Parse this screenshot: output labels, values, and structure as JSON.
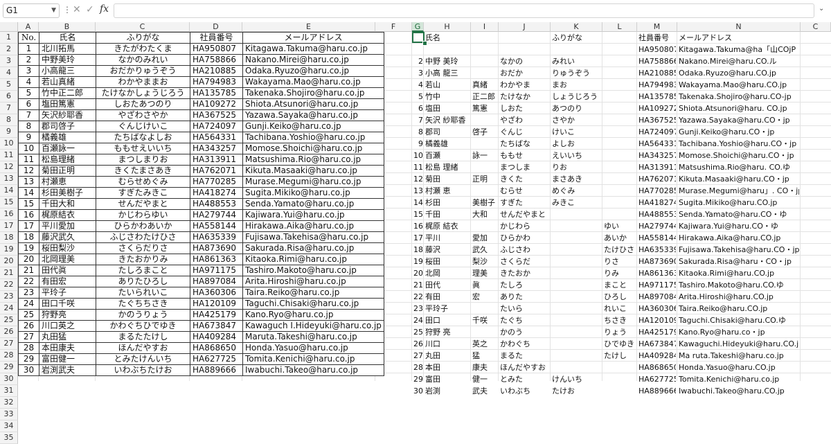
{
  "formula_bar": {
    "name_box": "G1",
    "more_icon": "more-vertical-icon",
    "cancel_icon": "x-icon",
    "enter_icon": "check-icon",
    "fx_label": "fx",
    "formula_value": ""
  },
  "colors": {
    "accent": "#217346",
    "header_bg": "#f3f3f3",
    "grid_line": "#e2e2e2"
  },
  "columns": [
    "A",
    "B",
    "C",
    "D",
    "E",
    "F",
    "G",
    "H",
    "I",
    "J",
    "K",
    "L",
    "M",
    "N",
    "C"
  ],
  "selected_column": "G",
  "row_numbers": [
    "1",
    "2",
    "3",
    "4",
    "5",
    "6",
    "7",
    "8",
    "9",
    "10",
    "11",
    "12",
    "13",
    "14",
    "15",
    "16",
    "17",
    "18",
    "19",
    "20",
    "21",
    "22",
    "23",
    "24",
    "25",
    "26",
    "27",
    "28",
    "29",
    "30",
    "31",
    "32",
    "33",
    "34",
    "35"
  ],
  "table1": {
    "headers": [
      "No.",
      "氏名",
      "ふりがな",
      "社員番号",
      "メールアドレス"
    ],
    "rows": [
      [
        "1",
        "北川拓馬",
        "きたがわたくま",
        "HA950807",
        "Kitagawa.Takuma@haru.co.jp"
      ],
      [
        "2",
        "中野美玲",
        "なかのみれい",
        "HA758866",
        "Nakano.Mirei@haru.co.jp"
      ],
      [
        "3",
        "小高龍三",
        "おだかりゅうぞう",
        "HA210885",
        "Odaka.Ryuzo@haru.co.jp"
      ],
      [
        "4",
        "若山真緒",
        "わかやままお",
        "HA794983",
        "Wakayama.Mao@haru.co.jp"
      ],
      [
        "5",
        "竹中正二郎",
        "たけなかしょうじろう",
        "HA135785",
        "Takenaka.Shojiro@haru.co.jp"
      ],
      [
        "6",
        "塩田篤憲",
        "しおたあつのり",
        "HA109272",
        "Shiota.Atsunori@haru.co.jp"
      ],
      [
        "7",
        "矢沢紗耶香",
        "やざわさやか",
        "HA367525",
        "Yazawa.Sayaka@haru.co.jp"
      ],
      [
        "8",
        "郡司啓子",
        "ぐんじけいこ",
        "HA724097",
        "Gunji.Keiko@haru.co.jp"
      ],
      [
        "9",
        "橘義雄",
        "たちばなよしお",
        "HA564331",
        "Tachibana.Yoshio@haru.co.jp"
      ],
      [
        "10",
        "百瀬詠一",
        "ももせえいいち",
        "HA343257",
        "Momose.Shoichi@haru.co.jp"
      ],
      [
        "11",
        "松島理緒",
        "まつしまりお",
        "HA313911",
        "Matsushima.Rio@haru.co.jp"
      ],
      [
        "12",
        "菊田正明",
        "きくたまさあき",
        "HA762071",
        "Kikuta.Masaaki@haru.co.jp"
      ],
      [
        "13",
        "村瀬恵",
        "むらせめぐみ",
        "HA770285",
        "Murase.Megumi@haru.co.jp"
      ],
      [
        "14",
        "杉田美樹子",
        "すぎたみきこ",
        "HA418274",
        "Sugita.Mikiko@haru.co.jp"
      ],
      [
        "15",
        "千田大和",
        "せんだやまと",
        "HA488553",
        "Senda.Yamato@haru.co.jp"
      ],
      [
        "16",
        "梶原結衣",
        "かじわらゆい",
        "HA279744",
        "Kajiwara.Yui@haru.co.jp"
      ],
      [
        "17",
        "平川愛加",
        "ひらかわあいか",
        "HA558144",
        "Hirakawa.Aika@haru.co.jp"
      ],
      [
        "18",
        "藤沢武久",
        "ふじさわたけひさ",
        "HA635339",
        "Fujisawa.Takehisa@haru.co.jp"
      ],
      [
        "19",
        "桜田梨沙",
        "さくらだりさ",
        "HA873690",
        "Sakurada.Risa@haru.co.jp"
      ],
      [
        "20",
        "北岡理美",
        "きたおかりみ",
        "HA861363",
        "Kitaoka.Rimi@haru.co.jp"
      ],
      [
        "21",
        "田代眞",
        "たしろまこと",
        "HA971175",
        "Tashiro.Makoto@haru.co.jp"
      ],
      [
        "22",
        "有田宏",
        "ありたひろし",
        "HA897084",
        "Arita.Hiroshi@haru.co.jp"
      ],
      [
        "23",
        "平玲子",
        "たいられいこ",
        "HA360306",
        "Taira.Reiko@haru.co.jp"
      ],
      [
        "24",
        "田口千咲",
        "たぐちちさき",
        "HA120109",
        "Taguchi.Chisaki@haru.co.jp"
      ],
      [
        "25",
        "狩野亮",
        "かのうりょう",
        "HA425179",
        "Kano.Ryo@haru.co.jp"
      ],
      [
        "26",
        "川口英之",
        "かわぐちひでゆき",
        "HA673847",
        "Kawaguch I.Hideyuki@haru.co.jp"
      ],
      [
        "27",
        "丸田猛",
        "まるたたけし",
        "HA409284",
        "Maruta.Takeshi@haru.co.jp"
      ],
      [
        "28",
        "本田康夫",
        "ほんだやすお",
        "HA868650",
        "Honda.Yasuo@haru.co.jp"
      ],
      [
        "29",
        "富田健一",
        "とみたけんいち",
        "HA627725",
        "Tomita.Kenichi@haru.co.jp"
      ],
      [
        "30",
        "岩渕武夫",
        "いわぶちたけお",
        "HA889666",
        "Iwabuchi.Takeo@haru.co.jp"
      ]
    ]
  },
  "table2": {
    "headers": {
      "H": "氏名",
      "K": "ふりがな",
      "M": "社員番号",
      "N": "メールアドレス"
    },
    "rows": [
      {
        "G": "",
        "H": "",
        "I": "",
        "J": "",
        "K": "",
        "L": "",
        "M": "HA950807",
        "N": "Kitagawa.Takuma@ha「山COjP"
      },
      {
        "G": "2",
        "H": "中野 美玲",
        "I": "",
        "J": "なかの",
        "K": "みれい",
        "L": "",
        "M": "HA758866",
        "N": "Nakano.Mirei@haru.CO.ル"
      },
      {
        "G": "3",
        "H": "小高 龍三",
        "I": "",
        "J": "おだか",
        "K": "りゅうぞう",
        "L": "",
        "M": "HA210885",
        "N": "Odaka.Ryuzo@haru.CO.jp"
      },
      {
        "G": "4",
        "H": "若山",
        "I": "真緒",
        "J": "わかやま",
        "K": "まお",
        "L": "",
        "M": "HA794983",
        "N": "Wakayama.Mao@haru.CO.jp"
      },
      {
        "G": "5",
        "H": "竹中",
        "I": "正二郎",
        "J": "たけなか",
        "K": "しょうじろう",
        "L": "",
        "M": "HA135785",
        "N": "Takenaka.Shojiro@haru.CO-jp"
      },
      {
        "G": "6",
        "H": "塩田",
        "I": "篤憲",
        "J": "しおた",
        "K": "あつのり",
        "L": "",
        "M": "HA109272",
        "N": "Shiota.Atsunori@haru. CO.jp"
      },
      {
        "G": "7",
        "H": "矢沢 紗耶香",
        "I": "",
        "J": "やざわ",
        "K": "さやか",
        "L": "",
        "M": "HA367525",
        "N": "Yazawa.Sayaka@haru.CO・jp"
      },
      {
        "G": "8",
        "H": "郡司",
        "I": "啓子",
        "J": "ぐんじ",
        "K": "けいこ",
        "L": "",
        "M": "HA724097",
        "N": "Gunji.Keiko@haru.CO・jp"
      },
      {
        "G": "9",
        "H": "橘義雄",
        "I": "",
        "J": "たちばな",
        "K": "よしお",
        "L": "",
        "M": "HA564331",
        "N": "Tachibana.Yoshio@haru.CO・jp"
      },
      {
        "G": "10",
        "H": "百瀬",
        "I": "詠一",
        "J": "ももせ",
        "K": "えいいち",
        "L": "",
        "M": "HA343257",
        "N": "Momose.Shoichi@haru.CO・jp"
      },
      {
        "G": "11",
        "H": "松島 理緒",
        "I": "",
        "J": "まつしま",
        "K": "りお",
        "L": "",
        "M": "HA313911",
        "N": "Matsushima.Rio@haru. CO.ゆ"
      },
      {
        "G": "12",
        "H": "菊田",
        "I": "正明",
        "J": "きくた",
        "K": "まさあき",
        "L": "",
        "M": "HA762071",
        "N": "Kikuta.Masaaki@haru.CO・jp"
      },
      {
        "G": "13",
        "H": "村瀬 恵",
        "I": "",
        "J": "むらせ",
        "K": "めぐみ",
        "L": "",
        "M": "HA770285",
        "N": "Murase.Megumi@haru」. CO・jp"
      },
      {
        "G": "14",
        "H": "杉田",
        "I": "美樹子",
        "J": "すぎた",
        "K": "みきこ",
        "L": "",
        "M": "HA418274",
        "N": "Sugita.Mikiko@haru.CO.jp"
      },
      {
        "G": "15",
        "H": "千田",
        "I": "大和",
        "J": "せんだやまと",
        "K": "",
        "L": "",
        "M": "HA488553",
        "N": "Senda.Yamato@haru.CO・ゆ"
      },
      {
        "G": "16",
        "H": "梶原 結衣",
        "I": "",
        "J": "かじわら",
        "K": "",
        "L": "ゆい",
        "M": "HA279744",
        "N": "Kajiwara.Yui@haru.CO・ゆ"
      },
      {
        "G": "17",
        "H": "平川",
        "I": "愛加",
        "J": "ひらかわ",
        "K": "",
        "L": "あいか",
        "M": "HA558144",
        "N": "Hirakawa.Aika@haru.CO.jp"
      },
      {
        "G": "18",
        "H": "藤沢",
        "I": "武久",
        "J": "ふじさわ",
        "K": "",
        "L": "たけひさ",
        "M": "HA635339",
        "N": "Fujisawa.Takehisa@haru.CO・jp"
      },
      {
        "G": "19",
        "H": "桜田",
        "I": "梨沙",
        "J": "さくらだ",
        "K": "",
        "L": "りさ",
        "M": "HA873690",
        "N": "Sakurada.Risa@haru・CO・jp"
      },
      {
        "G": "20",
        "H": "北岡",
        "I": "理美",
        "J": "きたおか",
        "K": "",
        "L": "りみ",
        "M": "HA861363",
        "N": "Kitaoka.Rimi@haru.CO.jp"
      },
      {
        "G": "21",
        "H": "田代",
        "I": "眞",
        "J": "たしろ",
        "K": "",
        "L": "まこと",
        "M": "HA971175",
        "N": "Tashiro.Makoto@haru.CO.ゆ"
      },
      {
        "G": "22",
        "H": "有田",
        "I": "宏",
        "J": "ありた",
        "K": "",
        "L": "ひろし",
        "M": "HA897084",
        "N": "Arita.Hiroshi@haru.CO.jp"
      },
      {
        "G": "23",
        "H": "平玲子",
        "I": "",
        "J": "たいら",
        "K": "",
        "L": "れいこ",
        "M": "HA360306",
        "N": "Taira.Reiko@haru.CO.jp"
      },
      {
        "G": "24",
        "H": "田口",
        "I": "千咲",
        "J": "たぐち",
        "K": "",
        "L": "ちさき",
        "M": "HA120109",
        "N": "Taguchi.Chisaki@haru.CO.ゆ"
      },
      {
        "G": "25",
        "H": "狩野 亮",
        "I": "",
        "J": "かのう",
        "K": "",
        "L": "りょう",
        "M": "HA425179",
        "N": "Kano.Ryo@haru.co・jp"
      },
      {
        "G": "26",
        "H": "川口",
        "I": "英之",
        "J": "かわぐち",
        "K": "",
        "L": "ひでゆき",
        "M": "HA673847",
        "N": "Kawaguchi.Hideyuki@haru.CO.jp"
      },
      {
        "G": "27",
        "H": "丸田",
        "I": "猛",
        "J": "まるた",
        "K": "",
        "L": "たけし",
        "M": "HA409284",
        "N": "Ma ruta.Takeshi@haru.co.jp"
      },
      {
        "G": "28",
        "H": "本田",
        "I": "康夫",
        "J": "ほんだやすお",
        "K": "",
        "L": "",
        "M": "HA868650",
        "N": "Honda.Yasuo@haru.CO.jp"
      },
      {
        "G": "29",
        "H": "富田",
        "I": "健一",
        "J": "とみた",
        "K": "けんいち",
        "L": "",
        "M": "HA627725",
        "N": "Tomita.Kenichi@haru.co.jp"
      },
      {
        "G": "30",
        "H": "岩渕",
        "I": "武夫",
        "J": "いわぶち",
        "K": "たけお",
        "L": "",
        "M": "HA889666",
        "N": "Iwabuchi.Takeo@haru.CO.jp"
      }
    ]
  }
}
